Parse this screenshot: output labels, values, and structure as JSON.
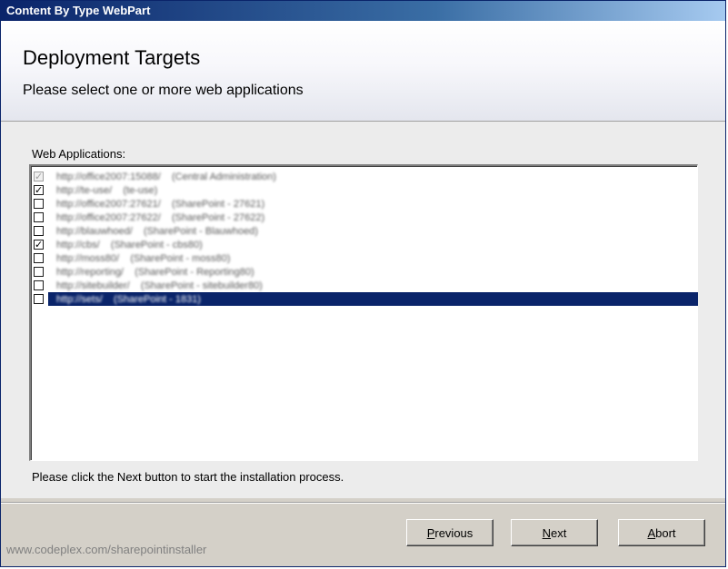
{
  "window": {
    "title": "Content By Type WebPart"
  },
  "header": {
    "title": "Deployment Targets",
    "subtitle": "Please select one or more web applications"
  },
  "list": {
    "label": "Web Applications:",
    "items": [
      {
        "text": "http://office2007:15088/    (Central Administration)",
        "checked": true,
        "disabled": true,
        "selected": false
      },
      {
        "text": "http://te-use/    (te-use)",
        "checked": true,
        "disabled": false,
        "selected": false
      },
      {
        "text": "http://office2007:27621/    (SharePoint - 27621)",
        "checked": false,
        "disabled": false,
        "selected": false
      },
      {
        "text": "http://office2007:27622/    (SharePoint - 27622)",
        "checked": false,
        "disabled": false,
        "selected": false
      },
      {
        "text": "http://blauwhoed/    (SharePoint - Blauwhoed)",
        "checked": false,
        "disabled": false,
        "selected": false
      },
      {
        "text": "http://cbs/    (SharePoint - cbs80)",
        "checked": true,
        "disabled": false,
        "selected": false
      },
      {
        "text": "http://moss80/    (SharePoint - moss80)",
        "checked": false,
        "disabled": false,
        "selected": false
      },
      {
        "text": "http://reporting/    (SharePoint - Reporting80)",
        "checked": false,
        "disabled": false,
        "selected": false
      },
      {
        "text": "http://sitebuilder/    (SharePoint - sitebuilder80)",
        "checked": false,
        "disabled": false,
        "selected": false
      },
      {
        "text": "http://sets/    (SharePoint - 1831)",
        "checked": false,
        "disabled": false,
        "selected": true
      }
    ]
  },
  "hint": "Please click the Next button to start the installation process.",
  "footer": {
    "link": "www.codeplex.com/sharepointinstaller"
  },
  "buttons": {
    "previous": {
      "accel": "P",
      "rest": "revious"
    },
    "next": {
      "accel": "N",
      "rest": "ext"
    },
    "abort": {
      "accel": "A",
      "rest": "bort"
    }
  },
  "colors": {
    "titlebar": "#0a246a",
    "selection": "#0a246a"
  }
}
